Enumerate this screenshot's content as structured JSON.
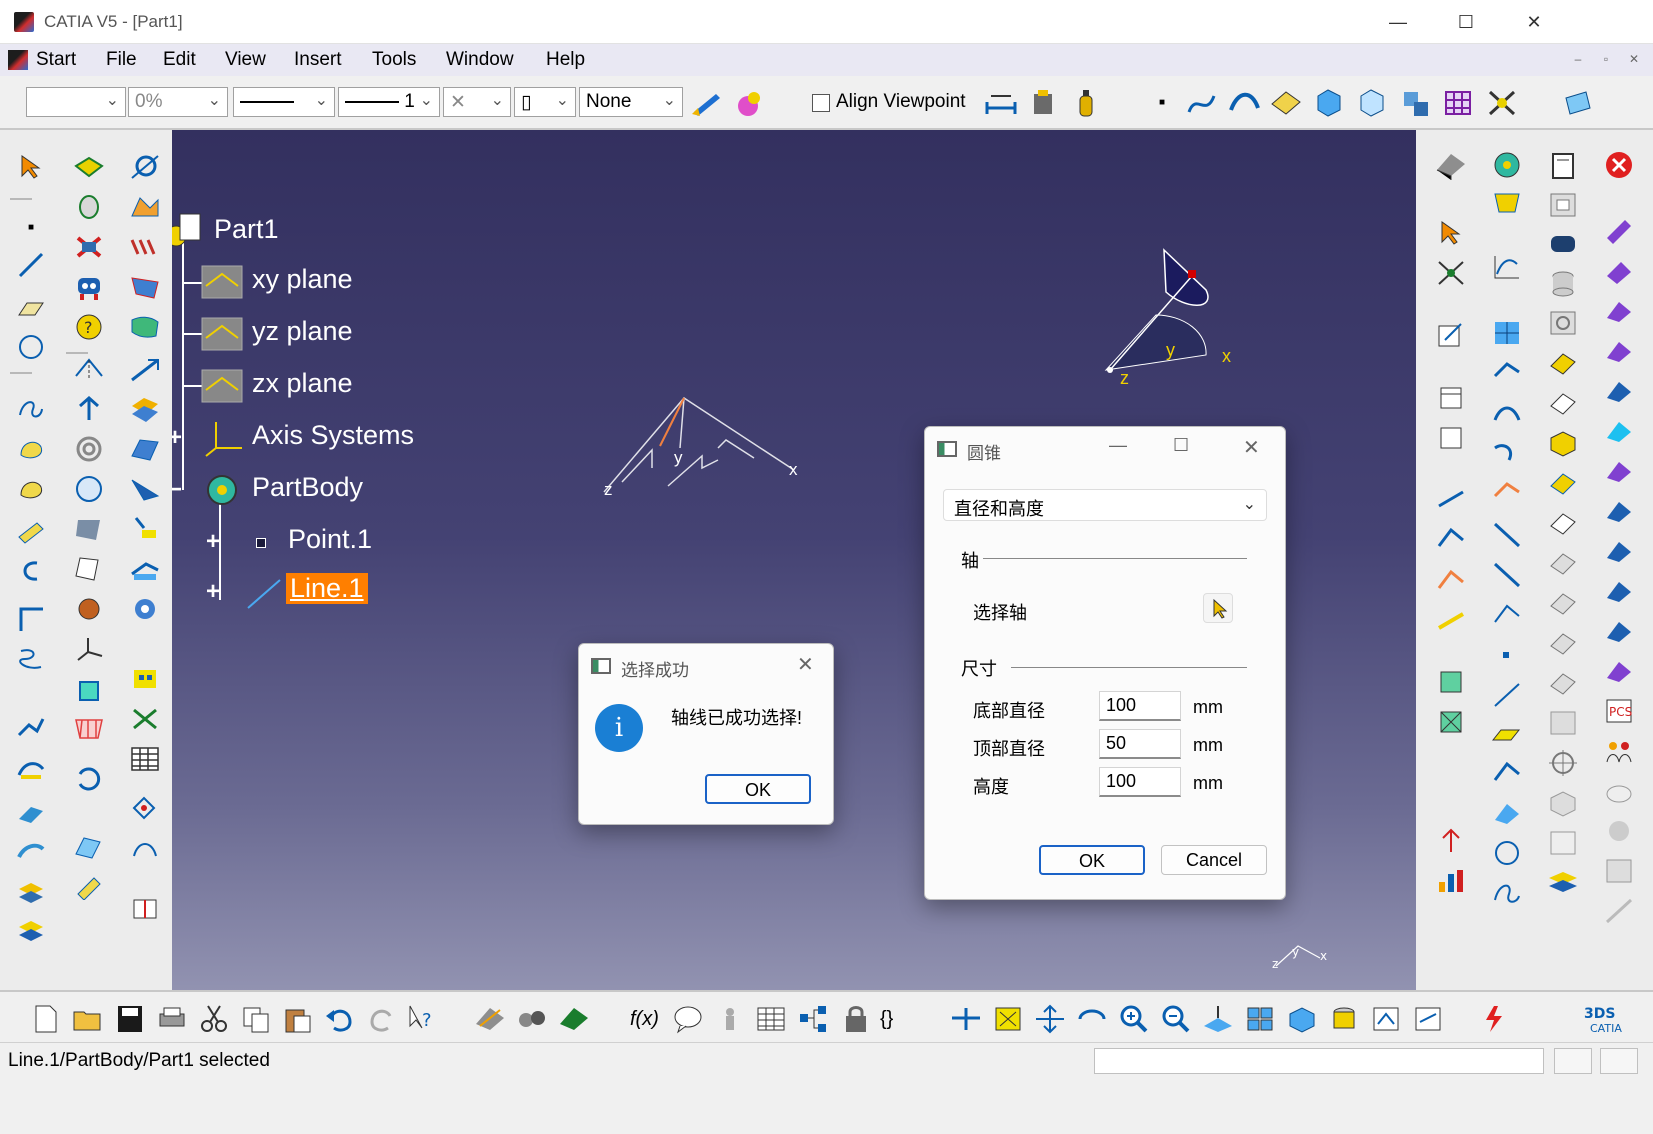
{
  "window": {
    "title": "CATIA V5 - [Part1]",
    "minimize": "—",
    "maximize": "☐",
    "close": "✕"
  },
  "menu": {
    "start": "Start",
    "file": "File",
    "edit": "Edit",
    "view": "View",
    "insert": "Insert",
    "tools": "Tools",
    "window": "Window",
    "help": "Help"
  },
  "toolbar": {
    "color_value": "",
    "transparency": "0%",
    "line_weight": "1",
    "layer": "None",
    "align_viewpoint": "Align Viewpoint",
    "align_checked": false
  },
  "tree": {
    "root": "Part1",
    "items": [
      "xy plane",
      "yz plane",
      "zx plane",
      "Axis Systems",
      "PartBody",
      "Point.1",
      "Line.1"
    ]
  },
  "compass": {
    "x": "x",
    "y": "y",
    "z": "z"
  },
  "canvas_axes": {
    "x": "x",
    "y": "y",
    "z": "z"
  },
  "cone_dialog": {
    "title": "圆锥",
    "mode": "直径和高度",
    "axis_group": "轴",
    "select_axis": "选择轴",
    "size_group": "尺寸",
    "bottom_diameter_label": "底部直径",
    "bottom_diameter": "100",
    "top_diameter_label": "顶部直径",
    "top_diameter": "50",
    "height_label": "高度",
    "height": "100",
    "unit": "mm",
    "ok": "OK",
    "cancel": "Cancel"
  },
  "info_dialog": {
    "title": "选择成功",
    "message": "轴线已成功选择!",
    "ok": "OK",
    "icon_glyph": "i"
  },
  "status": {
    "text": "Line.1/PartBody/Part1 selected"
  },
  "colors": {
    "canvas_top": "#33305f",
    "highlight": "#ff7f00",
    "accent": "#1a62c7"
  }
}
